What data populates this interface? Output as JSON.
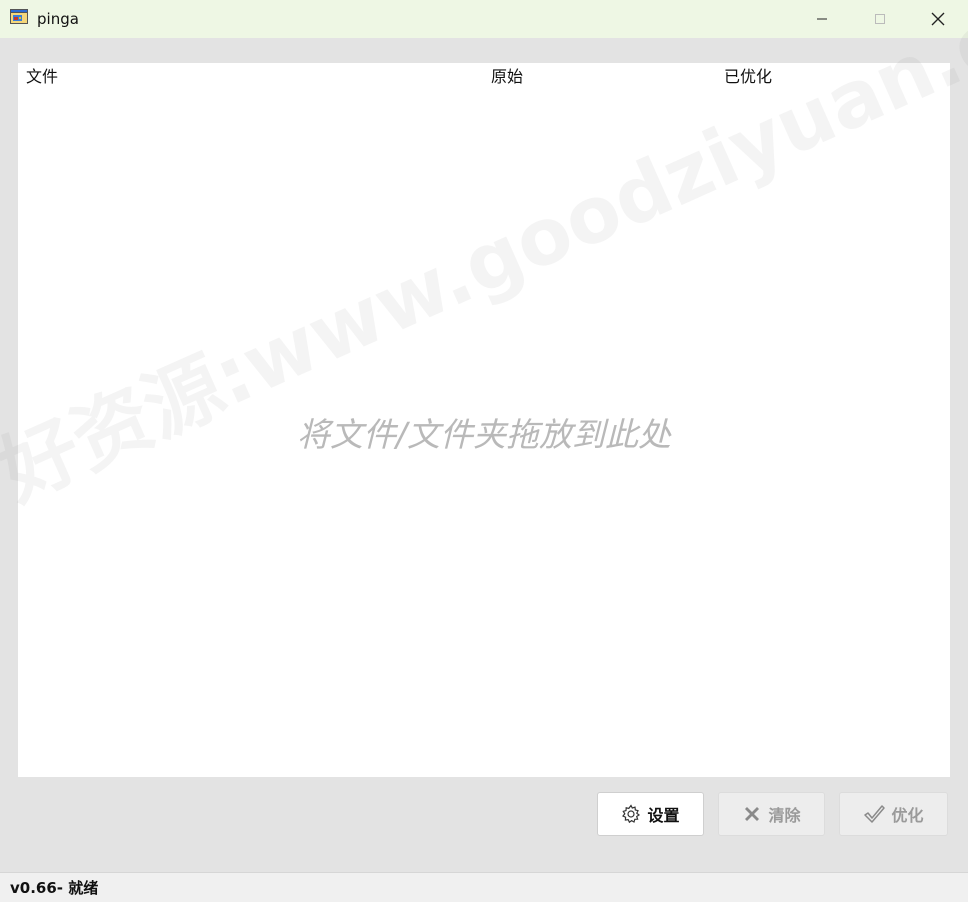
{
  "window": {
    "title": "pinga",
    "app_icon": "app-window-icon"
  },
  "file_list": {
    "columns": [
      "文件",
      "原始",
      "已优化"
    ],
    "drop_hint": "将文件/文件夹拖放到此处"
  },
  "watermark": {
    "text": "好资源:www.goodziyuan.com"
  },
  "buttons": {
    "settings": {
      "label": "设置",
      "icon": "gear-icon"
    },
    "clear": {
      "label": "清除",
      "icon": "cross-icon"
    },
    "optimize": {
      "label": "优化",
      "icon": "checkmark-icon"
    }
  },
  "status": {
    "text": "v0.66- 就绪"
  },
  "colors": {
    "titlebar": "#eef7e4",
    "background": "#e3e3e3",
    "panel": "#ffffff",
    "disabled_text": "#9a9a9a"
  }
}
